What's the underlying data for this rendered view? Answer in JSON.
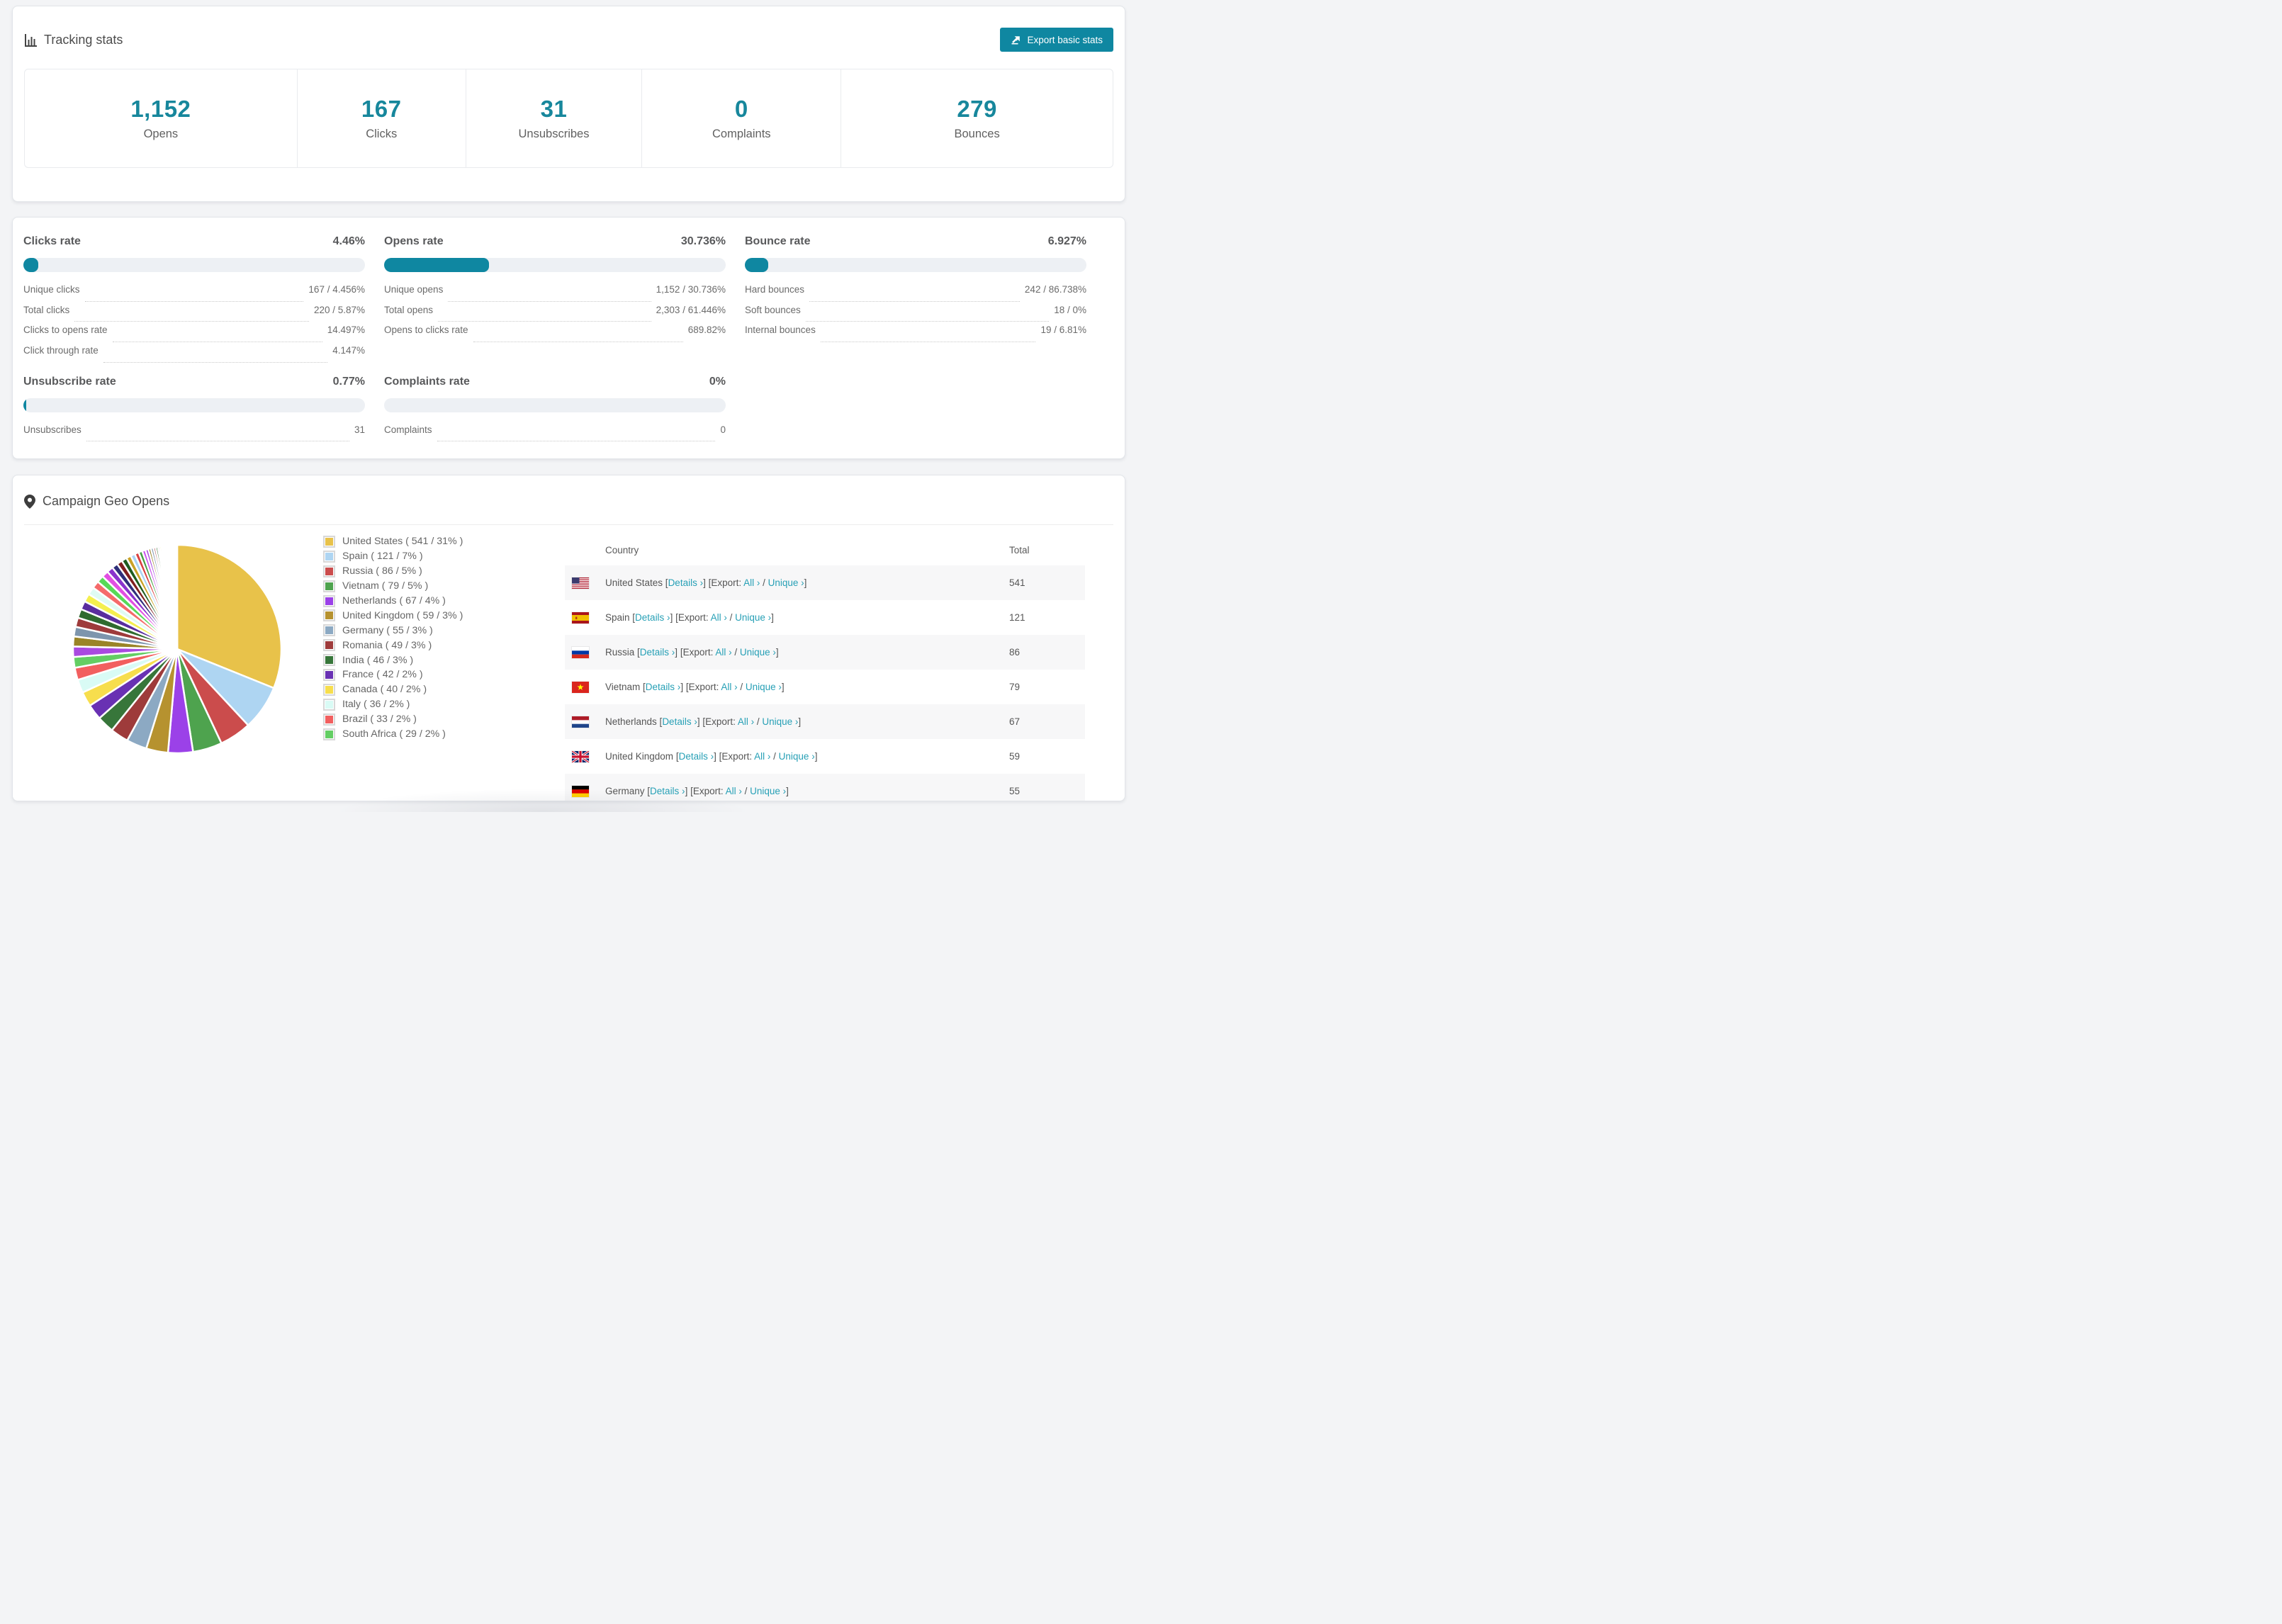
{
  "accent": "#0f87a1",
  "link_color": "#27a0b6",
  "tracking": {
    "title": "Tracking stats",
    "export_button": "Export basic stats",
    "stats": [
      {
        "value": "1,152",
        "label": "Opens"
      },
      {
        "value": "167",
        "label": "Clicks"
      },
      {
        "value": "31",
        "label": "Unsubscribes"
      },
      {
        "value": "0",
        "label": "Complaints"
      },
      {
        "value": "279",
        "label": "Bounces"
      }
    ],
    "cell_widths": [
      "25%",
      "15.5%",
      "16.2%",
      "18.3%",
      "25%"
    ]
  },
  "rates": [
    {
      "title": "Clicks rate",
      "value": "4.46%",
      "percent": 4.46,
      "rows": [
        {
          "label": "Unique clicks",
          "value": "167 / 4.456%"
        },
        {
          "label": "Total clicks",
          "value": "220 / 5.87%"
        },
        {
          "label": "Clicks to opens rate",
          "value": "14.497%"
        },
        {
          "label": "Click through rate",
          "value": "4.147%"
        }
      ]
    },
    {
      "title": "Opens rate",
      "value": "30.736%",
      "percent": 30.736,
      "rows": [
        {
          "label": "Unique opens",
          "value": "1,152 / 30.736%"
        },
        {
          "label": "Total opens",
          "value": "2,303 / 61.446%"
        },
        {
          "label": "Opens to clicks rate",
          "value": "689.82%"
        }
      ]
    },
    {
      "title": "Bounce rate",
      "value": "6.927%",
      "percent": 6.927,
      "rows": [
        {
          "label": "Hard bounces",
          "value": "242 / 86.738%"
        },
        {
          "label": "Soft bounces",
          "value": "18 / 0%"
        },
        {
          "label": "Internal bounces",
          "value": "19 / 6.81%"
        }
      ]
    },
    {
      "title": "Unsubscribe rate",
      "value": "0.77%",
      "percent": 0.77,
      "rows": [
        {
          "label": "Unsubscribes",
          "value": "31"
        }
      ]
    },
    {
      "title": "Complaints rate",
      "value": "0%",
      "percent": 0,
      "rows": [
        {
          "label": "Complaints",
          "value": "0"
        }
      ]
    }
  ],
  "geo": {
    "title": "Campaign Geo Opens",
    "table": {
      "headers": {
        "country": "Country",
        "total": "Total"
      },
      "rows": [
        {
          "flag": "us",
          "country": "United States",
          "total": "541"
        },
        {
          "flag": "es",
          "country": "Spain",
          "total": "121"
        },
        {
          "flag": "ru",
          "country": "Russia",
          "total": "86"
        },
        {
          "flag": "vn",
          "country": "Vietnam",
          "total": "79"
        },
        {
          "flag": "nl",
          "country": "Netherlands",
          "total": "67"
        },
        {
          "flag": "gb",
          "country": "United Kingdom",
          "total": "59"
        },
        {
          "flag": "de",
          "country": "Germany",
          "total": "55"
        }
      ]
    },
    "links": {
      "open": "[",
      "close": "]",
      "details": "Details ›",
      "export": "Export:",
      "all": "All ›",
      "slash": "/",
      "unique": "Unique ›"
    }
  },
  "chart_data": {
    "type": "pie",
    "title": "Campaign Geo Opens",
    "start_angle_deg": -90,
    "direction": "clockwise",
    "legend_position": "right",
    "labeled": [
      {
        "name": "United States",
        "value": 541,
        "pct": 31,
        "color": "#e8c24a"
      },
      {
        "name": "Spain",
        "value": 121,
        "pct": 7,
        "color": "#aed5f2"
      },
      {
        "name": "Russia",
        "value": 86,
        "pct": 5,
        "color": "#cb4c4c"
      },
      {
        "name": "Vietnam",
        "value": 79,
        "pct": 5,
        "color": "#4ea34e"
      },
      {
        "name": "Netherlands",
        "value": 67,
        "pct": 4,
        "color": "#9b41e8"
      },
      {
        "name": "United Kingdom",
        "value": 59,
        "pct": 3,
        "color": "#b6922f"
      },
      {
        "name": "Germany",
        "value": 55,
        "pct": 3,
        "color": "#8ca9c3"
      },
      {
        "name": "Romania",
        "value": 49,
        "pct": 3,
        "color": "#9e3b3b"
      },
      {
        "name": "India",
        "value": 46,
        "pct": 3,
        "color": "#37763a"
      },
      {
        "name": "France",
        "value": 42,
        "pct": 2,
        "color": "#6931b3"
      },
      {
        "name": "Canada",
        "value": 40,
        "pct": 2,
        "color": "#f7de4d"
      },
      {
        "name": "Italy",
        "value": 36,
        "pct": 2,
        "color": "#d9fbf5"
      },
      {
        "name": "Brazil",
        "value": 33,
        "pct": 2,
        "color": "#f25f5f"
      },
      {
        "name": "South Africa",
        "value": 29,
        "pct": 2,
        "color": "#63ce63"
      }
    ],
    "others_unlabeled_estimated_values": [
      28,
      27,
      26,
      25,
      24,
      23,
      22,
      21,
      20,
      19,
      18,
      17,
      16,
      15,
      14,
      13,
      12,
      11,
      10,
      9,
      8,
      7,
      7,
      6,
      6,
      5,
      5,
      4,
      4,
      3,
      3,
      3,
      2,
      2,
      2,
      2,
      2,
      1,
      1,
      1,
      1,
      1,
      1,
      1,
      1,
      1,
      1,
      1,
      1,
      1,
      1,
      1
    ],
    "others_palette": [
      "#a94ae0",
      "#9a8427",
      "#7d95ad",
      "#9e3b3b",
      "#2f6b2f",
      "#5a2d9e",
      "#f4ef4e",
      "#dffbf3",
      "#f56a6a",
      "#57d957",
      "#e24fe2",
      "#8a33cc",
      "#2f2f7a",
      "#801f1f",
      "#1f5c1f",
      "#c9a227",
      "#a9d3f5",
      "#d94040",
      "#44a044",
      "#cc55ee"
    ]
  }
}
